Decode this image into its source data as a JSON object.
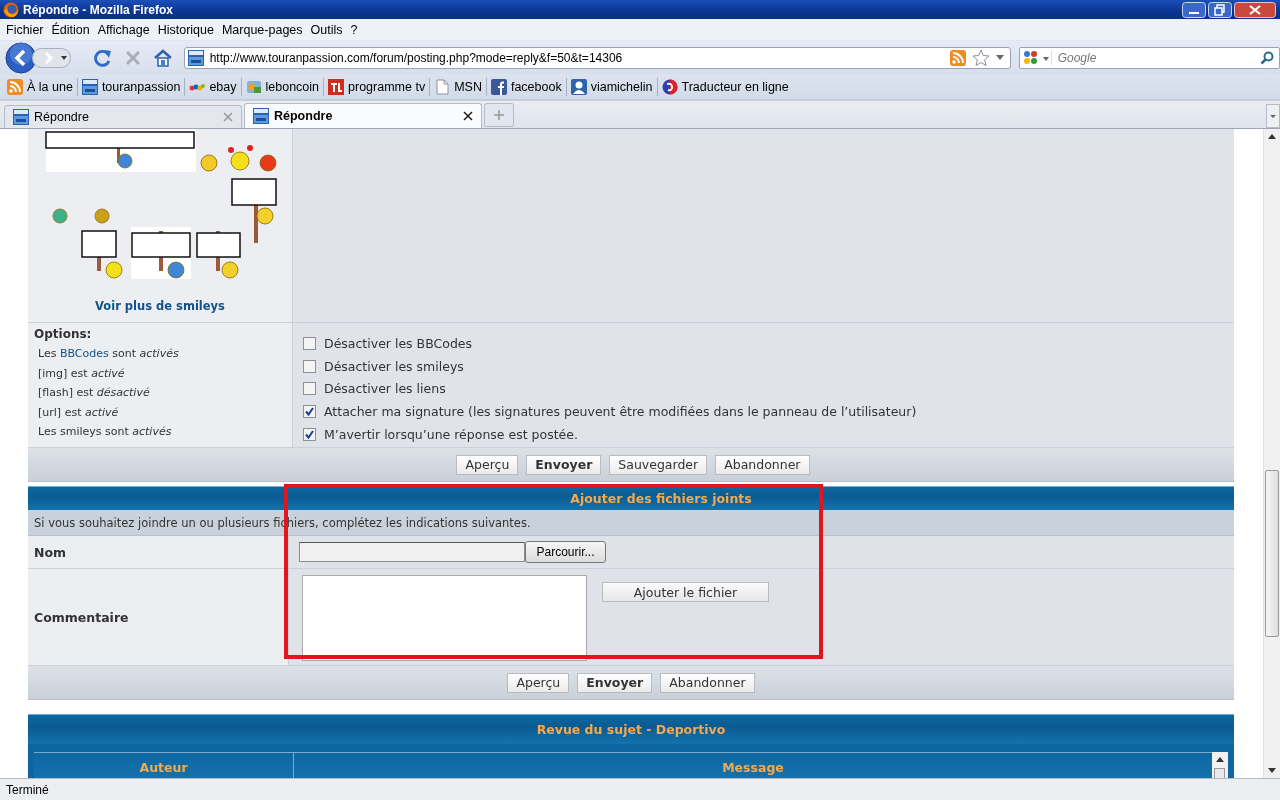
{
  "window": {
    "title": "Répondre - Mozilla Firefox"
  },
  "menu": [
    "Fichier",
    "Édition",
    "Affichage",
    "Historique",
    "Marque-pages",
    "Outils",
    "?"
  ],
  "address_bar": {
    "url": "http://www.touranpassion.com/forum/posting.php?mode=reply&f=50&t=14306"
  },
  "search": {
    "placeholder": "Google"
  },
  "bookmarks": [
    {
      "label": "À la une",
      "kind": "feed"
    },
    {
      "label": "touranpassion",
      "kind": "site"
    },
    {
      "label": "ebay",
      "kind": "ebay"
    },
    {
      "label": "leboncoin",
      "kind": "leboncoin"
    },
    {
      "label": "programme tv",
      "kind": "tv"
    },
    {
      "label": "MSN",
      "kind": "page"
    },
    {
      "label": "facebook",
      "kind": "facebook"
    },
    {
      "label": "viamichelin",
      "kind": "michelin"
    },
    {
      "label": "Traducteur en ligne",
      "kind": "translate"
    }
  ],
  "tabs": [
    {
      "label": "Répondre",
      "selected": false
    },
    {
      "label": "Répondre",
      "selected": true
    }
  ],
  "smileys": {
    "more_link": "Voir plus de smileys"
  },
  "options": {
    "title": "Options:",
    "notes": [
      {
        "before": "Les ",
        "link": "BBCodes",
        "after": " sont *activés*"
      },
      {
        "before": "[img] est *activé*"
      },
      {
        "before": "[flash] est *désactivé*"
      },
      {
        "before": "[url] est *activé*"
      },
      {
        "before": "Les smileys sont *activés*"
      }
    ]
  },
  "checkboxes": [
    {
      "label": "Désactiver les BBCodes",
      "checked": false
    },
    {
      "label": "Désactiver les smileys",
      "checked": false
    },
    {
      "label": "Désactiver les liens",
      "checked": false
    },
    {
      "label": "Attacher ma signature (les signatures peuvent être modifiées dans le panneau de l’utilisateur)",
      "checked": true
    },
    {
      "label": "M’avertir lorsqu’une réponse est postée.",
      "checked": true
    }
  ],
  "buttons": [
    {
      "label": "Aperçu",
      "primary": false
    },
    {
      "label": "Envoyer",
      "primary": true
    },
    {
      "label": "Sauvegarder",
      "primary": false
    },
    {
      "label": "Abandonner",
      "primary": false
    }
  ],
  "attachments": {
    "title": "Ajouter des fichiers joints",
    "hint": "Si vous souhaitez joindre un ou plusieurs fichiers, complétez les indications suivantes.",
    "name_label": "Nom",
    "browse_button": "Parcourir...",
    "comment_label": "Commentaire",
    "add_button": "Ajouter le fichier",
    "buttons": [
      {
        "label": "Aperçu",
        "primary": false
      },
      {
        "label": "Envoyer",
        "primary": true
      },
      {
        "label": "Abandonner",
        "primary": false
      }
    ]
  },
  "review": {
    "title": "Revue du sujet - Deportivo",
    "columns": [
      "Auteur",
      "Message"
    ]
  },
  "highlight_frame": true,
  "status_bar": {
    "text": "Terminé"
  }
}
